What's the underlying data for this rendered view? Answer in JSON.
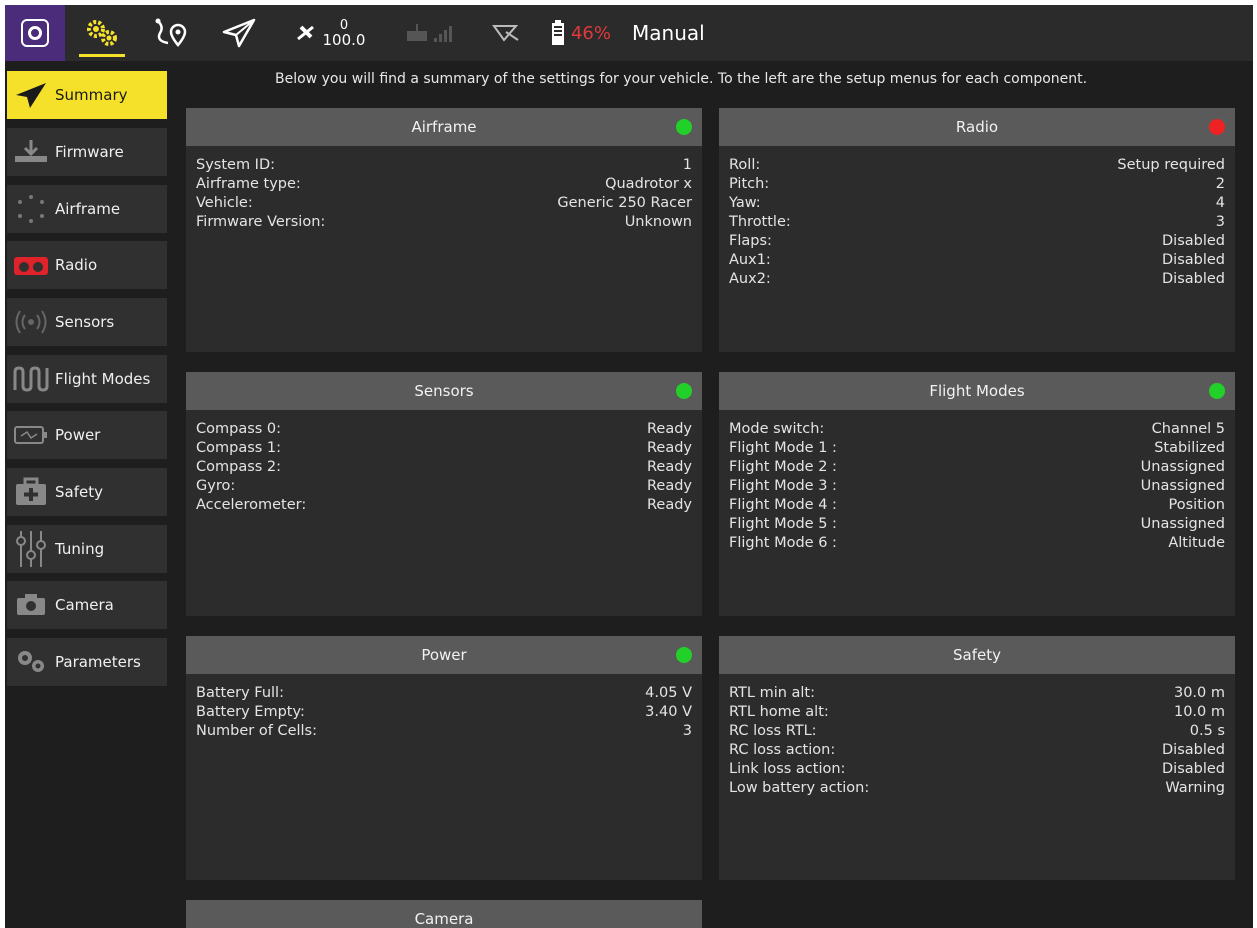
{
  "toolbar": {
    "gps_count": "0",
    "gps_hdop": "100.0",
    "battery_percent": "46%",
    "flight_mode": "Manual",
    "colors": {
      "accent": "#f5e12a",
      "battery": "#e0383a",
      "logo_bg": "#4a2c7a"
    }
  },
  "sidebar": {
    "items": [
      {
        "label": "Summary",
        "icon": "paper-plane-icon"
      },
      {
        "label": "Firmware",
        "icon": "download-icon"
      },
      {
        "label": "Airframe",
        "icon": "airframe-icon"
      },
      {
        "label": "Radio",
        "icon": "radio-icon"
      },
      {
        "label": "Sensors",
        "icon": "sensors-icon"
      },
      {
        "label": "Flight Modes",
        "icon": "waveform-icon"
      },
      {
        "label": "Power",
        "icon": "battery-icon"
      },
      {
        "label": "Safety",
        "icon": "first-aid-icon"
      },
      {
        "label": "Tuning",
        "icon": "sliders-icon"
      },
      {
        "label": "Camera",
        "icon": "camera-icon"
      },
      {
        "label": "Parameters",
        "icon": "gears-icon"
      }
    ]
  },
  "main": {
    "intro": "Below you will find a summary of the settings for your vehicle. To the left are the setup menus for each component.",
    "panels": {
      "airframe": {
        "title": "Airframe",
        "status": "green",
        "rows": [
          {
            "label": "System ID:",
            "value": "1"
          },
          {
            "label": "Airframe type:",
            "value": "Quadrotor x"
          },
          {
            "label": "Vehicle:",
            "value": "Generic 250 Racer"
          },
          {
            "label": "Firmware Version:",
            "value": "Unknown"
          }
        ]
      },
      "radio": {
        "title": "Radio",
        "status": "red",
        "rows": [
          {
            "label": "Roll:",
            "value": "Setup required"
          },
          {
            "label": "Pitch:",
            "value": "2"
          },
          {
            "label": "Yaw:",
            "value": "4"
          },
          {
            "label": "Throttle:",
            "value": "3"
          },
          {
            "label": "Flaps:",
            "value": "Disabled"
          },
          {
            "label": "Aux1:",
            "value": "Disabled"
          },
          {
            "label": "Aux2:",
            "value": "Disabled"
          }
        ]
      },
      "sensors": {
        "title": "Sensors",
        "status": "green",
        "rows": [
          {
            "label": "Compass 0:",
            "value": "Ready"
          },
          {
            "label": "Compass 1:",
            "value": "Ready"
          },
          {
            "label": "Compass 2:",
            "value": "Ready"
          },
          {
            "label": "Gyro:",
            "value": "Ready"
          },
          {
            "label": "Accelerometer:",
            "value": "Ready"
          }
        ]
      },
      "flight_modes": {
        "title": "Flight Modes",
        "status": "green",
        "rows": [
          {
            "label": "Mode switch:",
            "value": "Channel 5"
          },
          {
            "label": "Flight Mode 1 :",
            "value": "Stabilized"
          },
          {
            "label": "Flight Mode 2 :",
            "value": "Unassigned"
          },
          {
            "label": "Flight Mode 3 :",
            "value": "Unassigned"
          },
          {
            "label": "Flight Mode 4 :",
            "value": "Position"
          },
          {
            "label": "Flight Mode 5 :",
            "value": "Unassigned"
          },
          {
            "label": "Flight Mode 6 :",
            "value": "Altitude"
          }
        ]
      },
      "power": {
        "title": "Power",
        "status": "green",
        "rows": [
          {
            "label": "Battery Full:",
            "value": "4.05 V"
          },
          {
            "label": "Battery Empty:",
            "value": "3.40 V"
          },
          {
            "label": "Number of Cells:",
            "value": "3"
          }
        ]
      },
      "safety": {
        "title": "Safety",
        "status": "none",
        "rows": [
          {
            "label": "RTL min alt:",
            "value": "30.0 m"
          },
          {
            "label": "RTL home alt:",
            "value": "10.0 m"
          },
          {
            "label": "RC loss RTL:",
            "value": "0.5 s"
          },
          {
            "label": "RC loss action:",
            "value": "Disabled"
          },
          {
            "label": "Link loss action:",
            "value": "Disabled"
          },
          {
            "label": "Low battery action:",
            "value": "Warning"
          }
        ]
      },
      "camera": {
        "title": "Camera",
        "status": "none",
        "rows": []
      }
    },
    "status_colors": {
      "green": "#22d02a",
      "red": "#ee2222"
    }
  }
}
